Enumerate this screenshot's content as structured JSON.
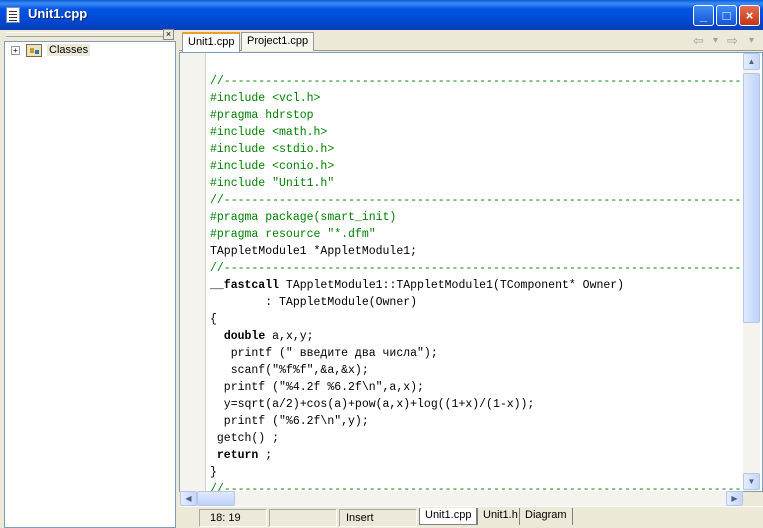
{
  "window": {
    "title": "Unit1.cpp"
  },
  "titlebar_buttons": {
    "minimize": "_",
    "maximize": "□",
    "close": "×"
  },
  "left_panel": {
    "close_glyph": "×",
    "tree": {
      "expander": "+",
      "label": "Classes"
    }
  },
  "tabs": [
    "Unit1.cpp",
    "Project1.cpp"
  ],
  "nav": {
    "back": "⇦",
    "back_drop": "▾",
    "forward": "⇨",
    "forward_drop": "▾"
  },
  "code_lines": [
    "//---------------------------------------------------------------------------",
    "#include <vcl.h>",
    "#pragma hdrstop",
    "#include <math.h>",
    "#include <stdio.h>",
    "#include <conio.h>",
    "#include \"Unit1.h\"",
    "//---------------------------------------------------------------------------",
    "#pragma package(smart_init)",
    "#pragma resource \"*.dfm\"",
    "TAppletModule1 *AppletModule1;",
    "//---------------------------------------------------------------------------",
    "__fastcall TAppletModule1::TAppletModule1(TComponent* Owner)",
    "        : TAppletModule(Owner)",
    "{",
    "  double a,x,y;",
    "   printf (\" введите два числа\");",
    "   scanf(\"%f%f\",&a,&x);",
    "  printf (\"%4.2f %6.2f\\n\",a,x);",
    "  y=sqrt(a/2)+cos(a)+pow(a,x)+log((1+x)/(1-x));",
    "  printf (\"%6.2f\\n\",y);",
    " getch() ;",
    " return ;",
    "}",
    "//---------------------------------------------------------------------------"
  ],
  "status": {
    "position": "18: 19",
    "mode": "Insert"
  },
  "bottom_tabs": [
    "Unit1.cpp",
    "Unit1.h",
    "Diagram"
  ],
  "scroll": {
    "up": "▲",
    "down": "▼",
    "left": "◀",
    "right": "▶"
  }
}
